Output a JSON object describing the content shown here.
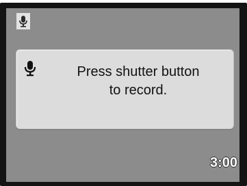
{
  "screen": {
    "mode_icon": "microphone-icon",
    "dialog_icon": "microphone-icon",
    "message_line1": "Press shutter button",
    "message_line2": "to record.",
    "remaining_time": "3:00"
  },
  "colors": {
    "bezel": "#141414",
    "lcd_background": "#8c8c8c",
    "dialog_background": "#dcdcdc",
    "text": "#111111",
    "time_text": "#ffffff"
  }
}
